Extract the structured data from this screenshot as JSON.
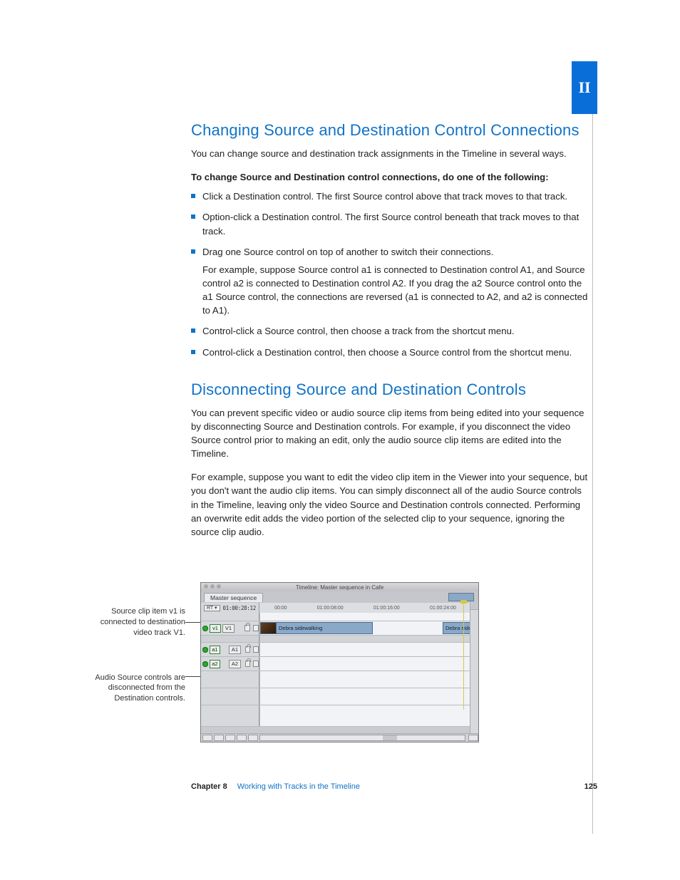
{
  "sideTab": "II",
  "section1": {
    "title": "Changing Source and Destination Control Connections",
    "intro": "You can change source and destination track assignments in the Timeline in several ways.",
    "lead": "To change Source and Destination control connections, do one of the following:",
    "bullets": [
      {
        "text": "Click a Destination control. The first Source control above that track moves to that track."
      },
      {
        "text": "Option-click a Destination control. The first Source control beneath that track moves to that track."
      },
      {
        "text": "Drag one Source control on top of another to switch their connections.",
        "sub": "For example, suppose Source control a1 is connected to Destination control A1, and Source control a2 is connected to Destination control A2. If you drag the a2 Source control onto the a1 Source control, the connections are reversed (a1 is connected to A2, and a2 is connected to A1)."
      },
      {
        "text": "Control-click a Source control, then choose a track from the shortcut menu."
      },
      {
        "text": "Control-click a Destination control, then choose a Source control from the shortcut menu."
      }
    ]
  },
  "section2": {
    "title": "Disconnecting Source and Destination Controls",
    "p1": "You can prevent specific video or audio source clip items from being edited into your sequence by disconnecting Source and Destination controls. For example, if you disconnect the video Source control prior to making an edit, only the audio source clip items are edited into the Timeline.",
    "p2": "For example, suppose you want to edit the video clip item in the Viewer into your sequence, but you don't want the audio clip items. You can simply disconnect all of the audio Source controls in the Timeline, leaving only the video Source and Destination controls connected. Performing an overwrite edit adds the video portion of the selected clip to your sequence, ignoring the source clip audio."
  },
  "callouts": {
    "c1": "Source clip item v1 is connected to destination video track V1.",
    "c2": "Audio Source controls are disconnected from the Destination controls."
  },
  "timeline": {
    "windowTitle": "Timeline: Master sequence in Cafe",
    "tab": "Master sequence",
    "rtLabel": "RT ▾",
    "timecode": "01:00:28:12",
    "rulerTicks": [
      "00:00",
      "01:00:08:00",
      "01:00:16:00",
      "01:00:24:00"
    ],
    "tracks": {
      "v1": {
        "src": "v1",
        "dst": "V1",
        "clipName": "Debra sidewalking"
      },
      "a1": {
        "src": "a1",
        "dst": "A1"
      },
      "a2": {
        "src": "a2",
        "dst": "A2"
      }
    }
  },
  "footer": {
    "chapter": "Chapter 8",
    "title": "Working with Tracks in the Timeline",
    "page": "125"
  }
}
